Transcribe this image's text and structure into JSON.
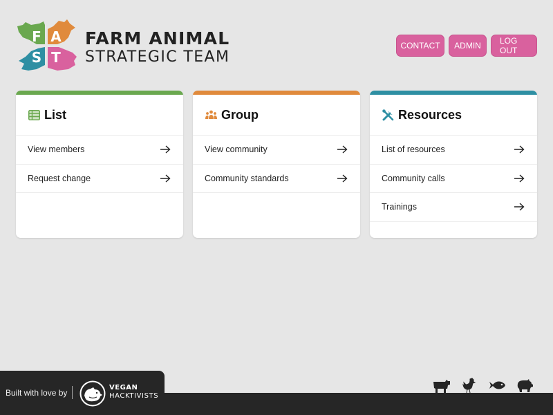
{
  "brand": {
    "letters": [
      "F",
      "A",
      "S",
      "T"
    ],
    "line1": "FARM ANIMAL",
    "line2": "STRATEGIC TEAM",
    "colors": {
      "green": "#6aa84f",
      "orange": "#e08a3c",
      "teal": "#2e8fa3",
      "pink": "#d9619e"
    }
  },
  "nav": {
    "contact": "CONTACT",
    "admin": "ADMIN",
    "logout": "LOG OUT",
    "color": "#d9619e"
  },
  "cards": [
    {
      "title": "List",
      "icon": "table-icon",
      "accent": "#6aa84f",
      "items": [
        "View members",
        "Request change"
      ]
    },
    {
      "title": "Group",
      "icon": "users-icon",
      "accent": "#e08a3c",
      "items": [
        "View community",
        "Community standards"
      ]
    },
    {
      "title": "Resources",
      "icon": "tools-icon",
      "accent": "#2e8fa3",
      "items": [
        "List of resources",
        "Community calls",
        "Trainings"
      ]
    }
  ],
  "footer": {
    "built_with": "Built with love by",
    "org_line1": "VEGAN",
    "org_line2": "HACKTIVISTS",
    "animals": [
      "cow-icon",
      "chicken-icon",
      "fish-icon",
      "pig-icon"
    ]
  }
}
